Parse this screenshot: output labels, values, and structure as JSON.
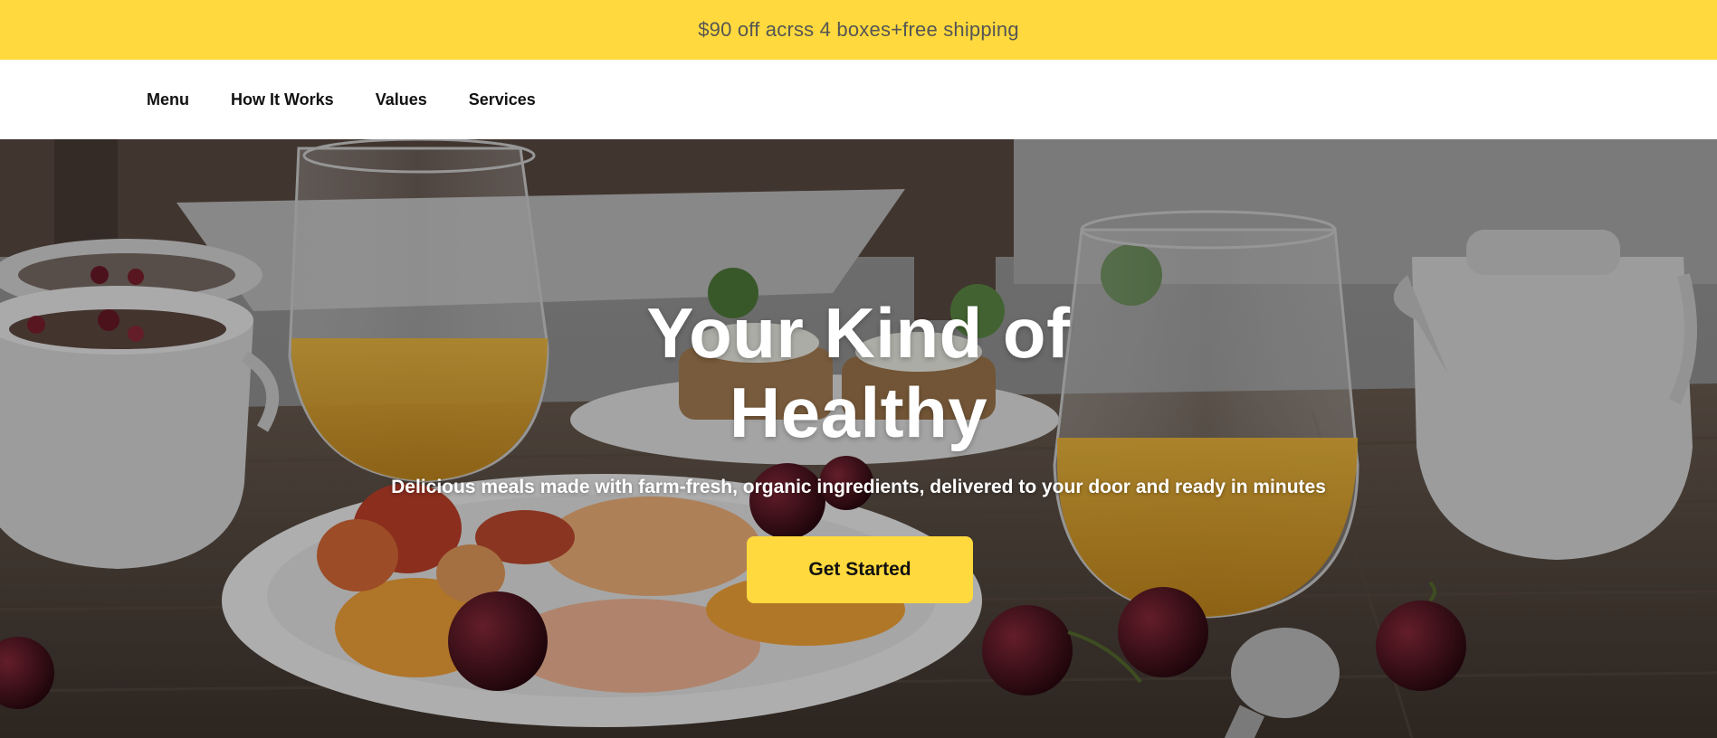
{
  "promo": {
    "text": "$90 off acrss 4 boxes+free shipping"
  },
  "nav": {
    "items": [
      {
        "label": "Menu"
      },
      {
        "label": "How It Works"
      },
      {
        "label": "Values"
      },
      {
        "label": "Services"
      }
    ]
  },
  "hero": {
    "title_line1": "Your Kind of",
    "title_line2": "Healthy",
    "subtitle": "Delicious meals made with farm-fresh, organic ingredients, delivered to your door and ready in minutes",
    "cta_label": "Get Started",
    "background_image": "breakfast-table-photo"
  },
  "colors": {
    "accent": "#ffd93d",
    "nav_text": "#111111",
    "promo_text": "#555555",
    "hero_text": "#ffffff"
  }
}
